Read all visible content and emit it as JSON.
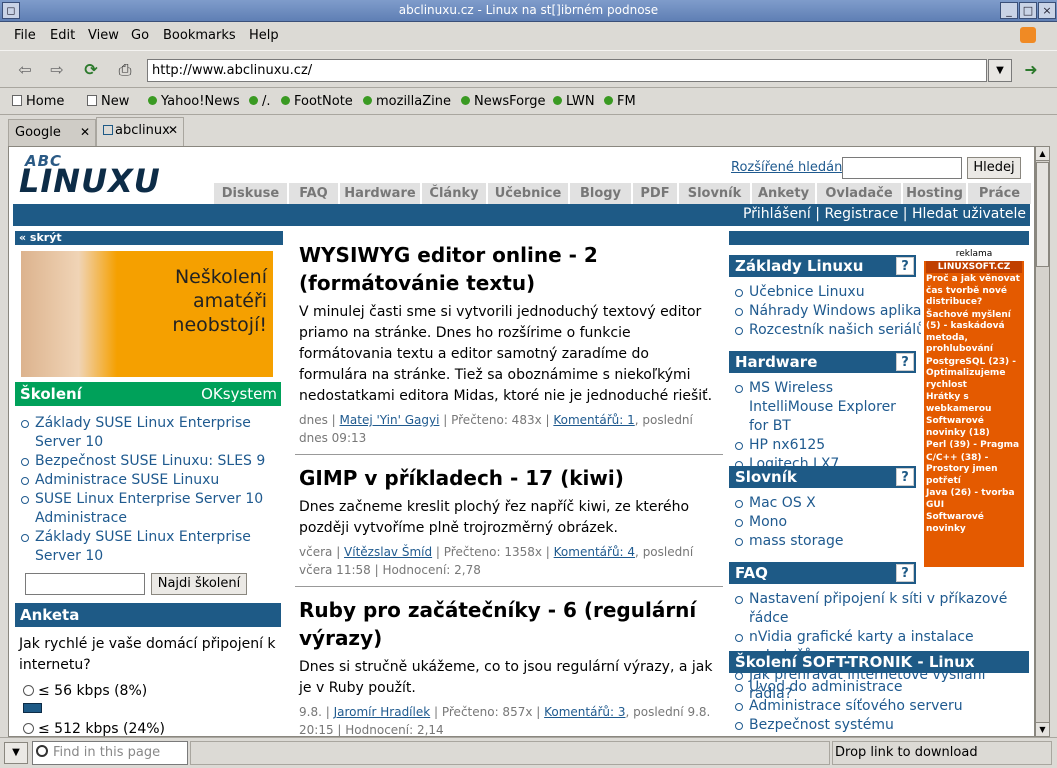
{
  "window": {
    "title": "abclinuxu.cz - Linux na st[]ibrném podnose"
  },
  "menu": [
    "File",
    "Edit",
    "View",
    "Go",
    "Bookmarks",
    "Help"
  ],
  "nav": {
    "url": "http://www.abclinuxu.cz/"
  },
  "bookmarks": [
    "Home",
    "New",
    "Yahoo!News",
    "/.",
    "FootNote",
    "mozillaZine",
    "NewsForge",
    "LWN",
    "FM"
  ],
  "tabs": [
    "Google",
    "abclinux"
  ],
  "status": {
    "find_placeholder": "Find in this page",
    "message": "Drop link to download"
  },
  "site": {
    "logo_abc": "ABC",
    "logo_linux": "LINUXU",
    "adv_search": "Rozšířené hledání",
    "search_button": "Hledej",
    "tabs": [
      "Diskuse",
      "FAQ",
      "Hardware",
      "Články",
      "Učebnice",
      "Blogy",
      "PDF",
      "Slovník",
      "Ankety",
      "Ovladače",
      "Hosting",
      "Práce"
    ],
    "userbar": "Přihlášení | Registrace | Hledat uživatele",
    "hide": "« skrýt",
    "banner_text": "Neškolení amatéři neobstojí!",
    "skoleni": {
      "title": "Školení",
      "brand": "OKsystem",
      "items": [
        "Základy SUSE Linux Enterprise Server 10",
        "Bezpečnost SUSE Linuxu: SLES 9",
        "Administrace SUSE Linuxu",
        "SUSE Linux Enterprise Server 10 Administrace",
        "Základy SUSE Linux Enterprise Server 10"
      ],
      "button": "Najdi školení"
    },
    "anketa": {
      "title": "Anketa",
      "question": "Jak rychlé je vaše domácí připojení k internetu?",
      "options": [
        "≤ 56 kbps (8%)",
        "≤ 512 kbps (24%)"
      ],
      "percents": [
        8,
        24
      ]
    },
    "articles": [
      {
        "title": "WYSIWYG editor online - 2 (formátovánie textu)",
        "perex": "V minulej časti sme si vytvorili jednoduchý textový editor priamo na stránke. Dnes ho rozšírime o funkcie formátovania textu a editor samotný zaradíme do formulára na stránke. Tiež sa oboznámime s niekoľkými nedostatkami editora Midas, ktoré nie je jednoduché riešiť.",
        "date": "dnes",
        "author": "Matej 'Yin' Gagyi",
        "read": "Přečteno: 483x",
        "comments": "Komentářů: 1",
        "last": "poslední dnes 09:13",
        "rating": ""
      },
      {
        "title": "GIMP v příkladech - 17 (kiwi)",
        "perex": "Dnes začneme kreslit plochý řez napříč kiwi, ze kterého později vytvoříme plně trojrozměrný obrázek.",
        "date": "včera",
        "author": "Vítězslav Šmíd",
        "read": "Přečteno: 1358x",
        "comments": "Komentářů: 4",
        "last": "poslední včera 11:58",
        "rating": "Hodnocení: 2,78"
      },
      {
        "title": "Ruby pro začátečníky - 6 (regulární výrazy)",
        "perex": "Dnes si stručně ukážeme, co to jsou regulární výrazy, a jak je v Ruby použít.",
        "date": "9.8.",
        "author": "Jaromír Hradílek",
        "read": "Přečteno: 857x",
        "comments": "Komentářů: 3",
        "last": "poslední 9.8. 20:15",
        "rating": "Hodnocení: 2,14"
      }
    ],
    "right": {
      "boxes": [
        {
          "title": "Základy Linuxu",
          "items": [
            "Učebnice Linuxu",
            "Náhrady Windows aplikací",
            "Rozcestník našich seriálů"
          ]
        },
        {
          "title": "Hardware",
          "items": [
            "MS Wireless IntelliMouse Explorer for BT",
            "HP nx6125",
            "Logitech LX7"
          ]
        },
        {
          "title": "Slovník",
          "items": [
            "Mac OS X",
            "Mono",
            "mass storage"
          ]
        },
        {
          "title": "FAQ",
          "items": [
            "Nastavení připojení k síti v příkazové řádce",
            "nVidia grafické karty a instalace ovladačů",
            "Jak přehrávat internetové vysílání rádia?"
          ]
        }
      ],
      "wide_box": {
        "title": "Školení SOFT-TRONIK - Linux",
        "items": [
          "Úvod do administrace",
          "Administrace síťového serveru",
          "Bezpečnost systému"
        ]
      },
      "ad": {
        "label": "reklama",
        "head": "LINUXSOFT.CZ",
        "items": [
          "Proč a jak věnovat čas tvorbě nové distribuce?",
          "Šachové myšlení (5) - kaskádová metoda, prohlubování",
          "PostgreSQL (23) - Optimalizujeme rychlost",
          "Hrátky s webkamerou",
          "Softwarové novinky (18)",
          "Perl (39) - Pragma",
          "C/C++ (38) - Prostory jmen potřetí",
          "Java (26) - tvorba GUI",
          "Softwarové novinky"
        ]
      }
    }
  }
}
